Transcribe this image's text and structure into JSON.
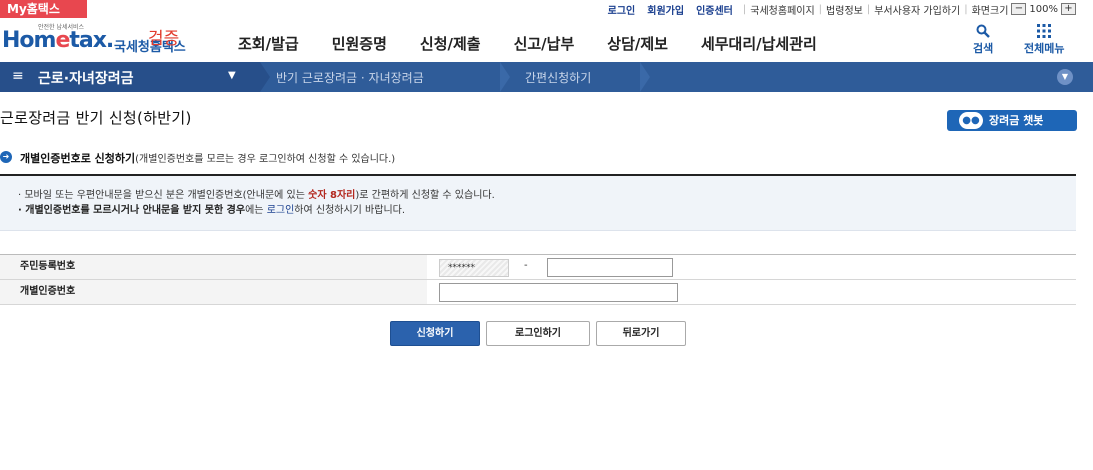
{
  "topbar": {
    "my_hometax": "My홈택스",
    "login": "로그인",
    "signup": "회원가입",
    "cert_center": "인증센터",
    "links": [
      "국세청홈페이지",
      "법령정보",
      "부서사용자 가입하기",
      "화면크기"
    ],
    "zoom_minus": "−",
    "zoom_value": "100%",
    "zoom_plus": "+"
  },
  "header": {
    "logo_small": "안전한 납세서비스",
    "logo_main_1": "Hom",
    "logo_main_e": "e",
    "logo_main_2": "tax.",
    "logo_kr": "국세청홈택스",
    "verify": "검증",
    "menu": [
      "조회/발급",
      "민원증명",
      "신청/제출",
      "신고/납부",
      "상담/제보",
      "세무대리/납세관리"
    ],
    "search": "검색",
    "all_menu": "전체메뉴"
  },
  "location": {
    "menu_icon": "≡",
    "title": "근로·자녀장려금",
    "caret": "▼",
    "crumbs": [
      "반기 근로장려금 · 자녀장려금",
      "간편신청하기"
    ],
    "expand": "▼"
  },
  "page": {
    "title": "근로장려금 반기 신청(하반기)",
    "chatbot_label": "장려금 챗봇",
    "chatbot_icon": "●●"
  },
  "section": {
    "arrow": "➜",
    "title": "개별인증번호로 신청하기",
    "subtitle": "(개별인증번호를 모르는 경우 로그인하여 신청할 수 있습니다.)"
  },
  "info": {
    "line1_a": "· 모바일 또는 우편안내문을 받으신 분은 개별인증번호(안내문에 있는 ",
    "line1_red": "숫자 8자리",
    "line1_b": ")로 간편하게 신청할 수 있습니다.",
    "line2_bold": "· 개별인증번호를 모르시거나 안내문을 받지 못한 경우",
    "line2_a": "에는 ",
    "line2_blue": "로그인",
    "line2_b": "하여 신청하시기 바랍니다."
  },
  "form": {
    "rrn_label": "주민등록번호",
    "rrn_front_masked": "******",
    "rrn_dash": "-",
    "rrn_back_value": "",
    "auth_label": "개별인증번호",
    "auth_value": ""
  },
  "buttons": {
    "apply": "신청하기",
    "login": "로그인하기",
    "back": "뒤로가기"
  },
  "colors": {
    "brand_blue": "#1c5aa6",
    "nav_bar": "#2f5c99",
    "my_tab_red": "#e8474f",
    "primary_button": "#2b62ad",
    "emphasis_red": "#b3271e"
  }
}
